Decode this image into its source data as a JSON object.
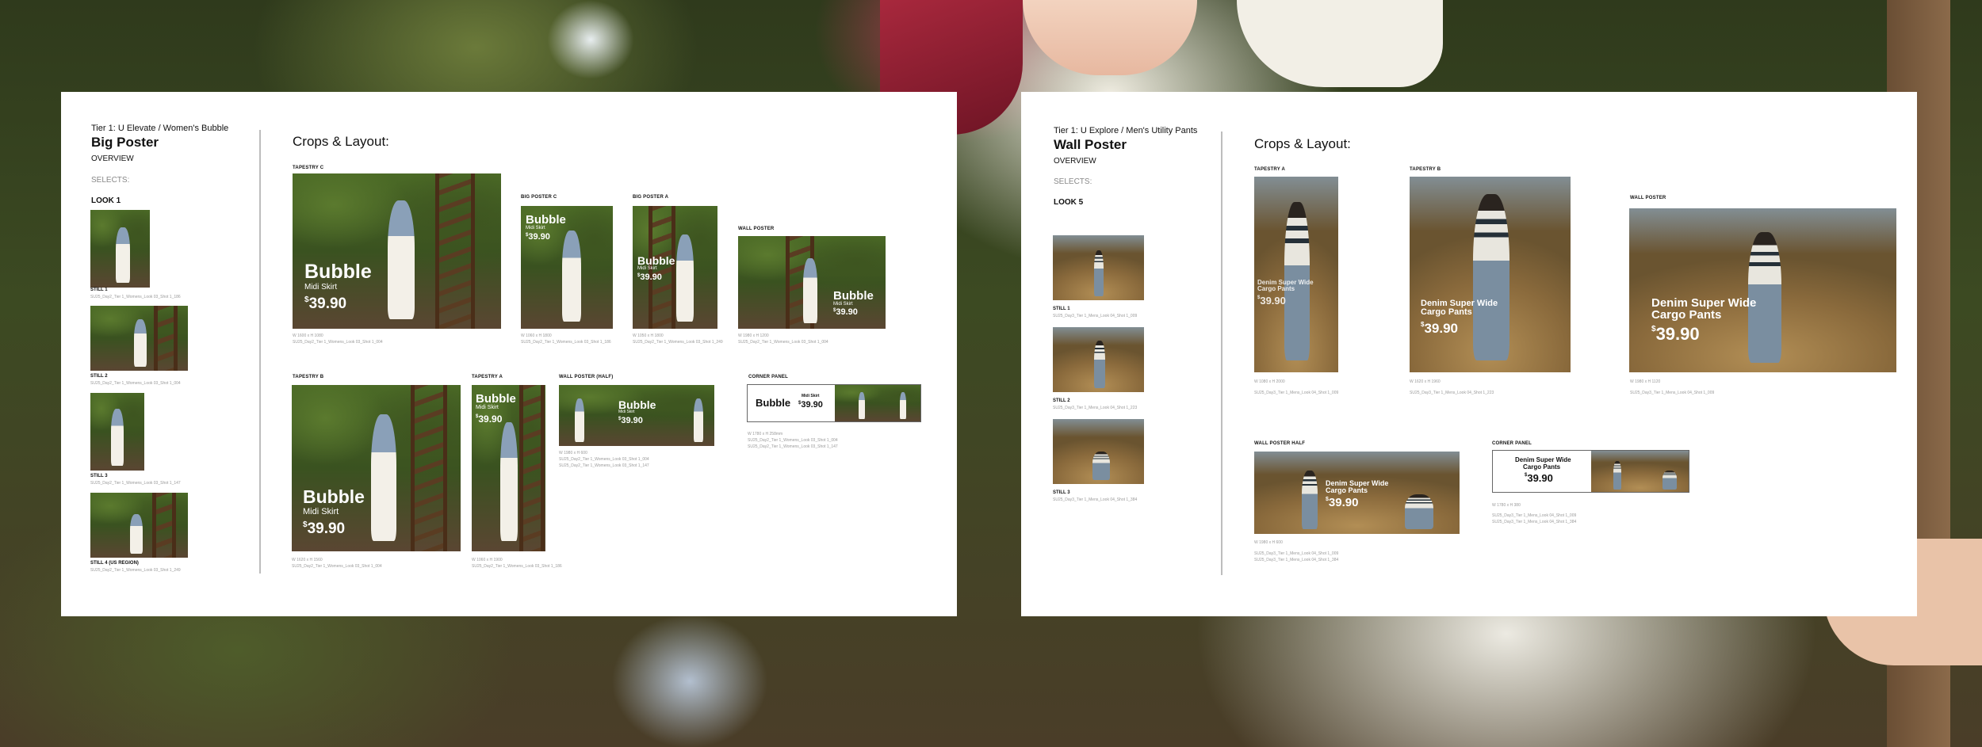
{
  "left": {
    "tier": "Tier 1: U Elevate / Women's Bubble",
    "title": "Big Poster",
    "overview": "OVERVIEW",
    "selects": "SELECTS:",
    "look": "LOOK 1",
    "crops_title": "Crops & Layout:",
    "stills": [
      {
        "label": "STILL 1",
        "file": "SU25_Day2_Tier 1_Womens_Look 03_Shot 1_186"
      },
      {
        "label": "STILL 2",
        "file": "SU25_Day2_Tier 1_Womens_Look 03_Shot 1_004"
      },
      {
        "label": "STILL 3",
        "file": "SU25_Day2_Tier 1_Womens_Look 03_Shot 1_147"
      },
      {
        "label": "STILL 4 (US REGION)",
        "file": "SU25_Day2_Tier 1_Womens_Look 03_Shot 1_249"
      }
    ],
    "crops": {
      "tapestry_c": {
        "label": "TAPESTRY C",
        "meta1": "W 1600 x H 1080",
        "meta2": "SU25_Day2_Tier 1_Womens_Look 03_Shot 1_004"
      },
      "big_poster_c": {
        "label": "BIG POSTER C",
        "meta1": "W 1060 x H 1800",
        "meta2": "SU25_Day2_Tier 1_Womens_Look 03_Shot 1_186"
      },
      "big_poster_a": {
        "label": "BIG POSTER A",
        "meta1": "W 1050 x H 1800",
        "meta2": "SU25_Day2_Tier 1_Womens_Look 03_Shot 1_249"
      },
      "wall_poster": {
        "label": "WALL POSTER",
        "meta1": "W 1980 x H 1200",
        "meta2": "SU25_Day2_Tier 1_Womens_Look 03_Shot 1_004"
      },
      "tapestry_b": {
        "label": "TAPESTRY B",
        "meta1": "W 1620 x H 1560",
        "meta2": "SU25_Day2_Tier 1_Womens_Look 03_Shot 1_004"
      },
      "tapestry_a": {
        "label": "TAPESTRY A",
        "meta1": "W 1060 x H 1900",
        "meta2": "SU25_Day2_Tier 1_Womens_Look 03_Shot 1_186"
      },
      "wall_poster_half": {
        "label": "WALL POSTER (HALF)",
        "meta1": "W 1980 x H 600",
        "meta2": "SU25_Day2_Tier 1_Womens_Look 03_Shot 1_004",
        "meta3": "SU25_Day2_Tier 1_Womens_Look 03_Shot 1_147"
      },
      "corner_panel": {
        "label": "CORNER PANEL",
        "meta1": "W 1780 x H 258mm",
        "meta2": "SU25_Day2_Tier 1_Womens_Look 03_Shot 1_004",
        "meta3": "SU25_Day2_Tier 1_Womens_Look 03_Shot 1_147"
      }
    },
    "overlay": {
      "brand": "Bubble",
      "sub": "Midi Skirt",
      "currency": "$",
      "price": "39.90",
      "corner_sub": "Midi Skirt"
    }
  },
  "right": {
    "tier": "Tier 1: U Explore / Men's Utility Pants",
    "title": "Wall Poster",
    "overview": "OVERVIEW",
    "selects": "SELECTS:",
    "look": "LOOK 5",
    "crops_title": "Crops & Layout:",
    "stills": [
      {
        "label": "STILL 1",
        "file": "SU25_Day3_Tier 1_Mens_Look 04_Shot 1_009"
      },
      {
        "label": "STILL 2",
        "file": "SU25_Day3_Tier 1_Mens_Look 04_Shot 1_223"
      },
      {
        "label": "STILL 3",
        "file": "SU25_Day3_Tier 1_Mens_Look 04_Shot 1_384"
      }
    ],
    "crops": {
      "tapestry_a": {
        "label": "TAPESTRY A",
        "meta1": "W 1080 x H 2000",
        "meta2": "SU25_Day3_Tier 1_Mens_Look 04_Shot 1_009"
      },
      "tapestry_b": {
        "label": "TAPESTRY B",
        "meta1": "W 1620 x H 1960",
        "meta2": "SU25_Day3_Tier 1_Mens_Look 04_Shot 1_223"
      },
      "wall_poster": {
        "label": "WALL POSTER",
        "meta1": "W 1980 x H 1120",
        "meta2": "SU25_Day3_Tier 1_Mens_Look 04_Shot 1_009"
      },
      "wall_poster_half": {
        "label": "WALL POSTER HALF",
        "meta1": "W 1980 x H 600",
        "meta2": "SU25_Day3_Tier 1_Mens_Look 04_Shot 1_009",
        "meta3": "SU25_Day3_Tier 1_Mens_Look 04_Shot 1_384"
      },
      "corner_panel": {
        "label": "CORNER PANEL",
        "meta1": "W 1780 x H 380",
        "meta2": "SU25_Day3_Tier 1_Mens_Look 04_Shot 1_009",
        "meta3": "SU25_Day3_Tier 1_Mens_Look 04_Shot 1_384"
      }
    },
    "overlay": {
      "line1": "Denim Super Wide",
      "line2": "Cargo Pants",
      "currency": "$",
      "price": "39.90"
    }
  }
}
